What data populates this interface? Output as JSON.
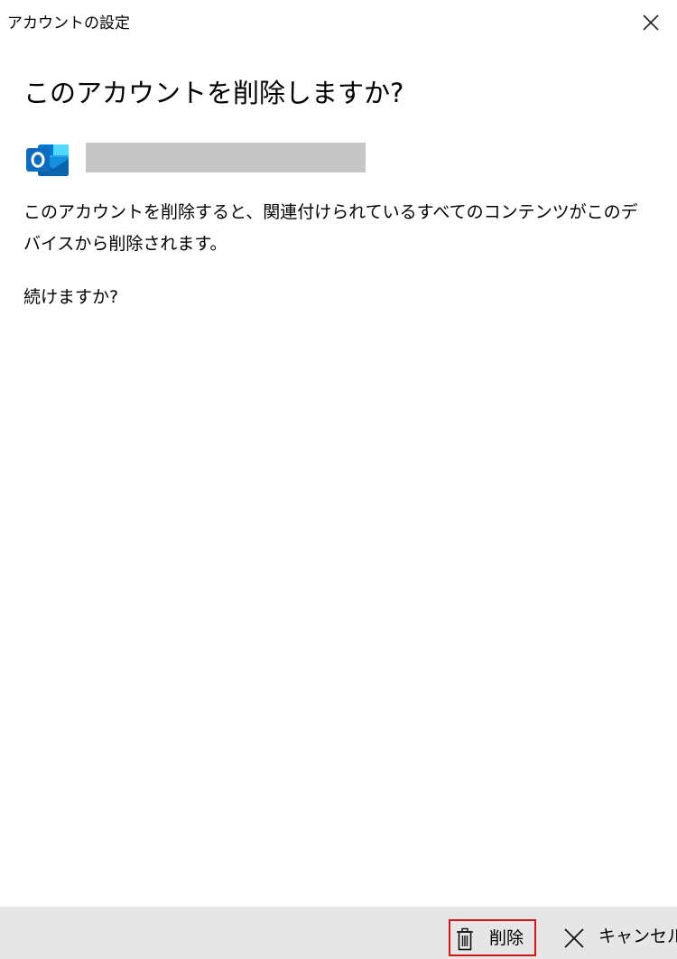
{
  "window": {
    "title": "アカウントの設定",
    "close_icon": "close-icon"
  },
  "dialog": {
    "heading": "このアカウントを削除しますか?",
    "account": {
      "app_icon": "outlook-icon",
      "email": ""
    },
    "message": "このアカウントを削除すると、関連付けられているすべてのコンテンツがこのデバイスから削除されます。",
    "confirm": "続けますか?"
  },
  "footer": {
    "delete_label": "削除",
    "delete_icon": "trash-icon",
    "cancel_label": "キャンセル",
    "cancel_icon": "close-icon"
  },
  "colors": {
    "highlight_border": "#d1141b",
    "footer_bg": "#e6e6e6",
    "outlook_blue": "#0f6cbd",
    "redacted": "#c6c6c6"
  }
}
